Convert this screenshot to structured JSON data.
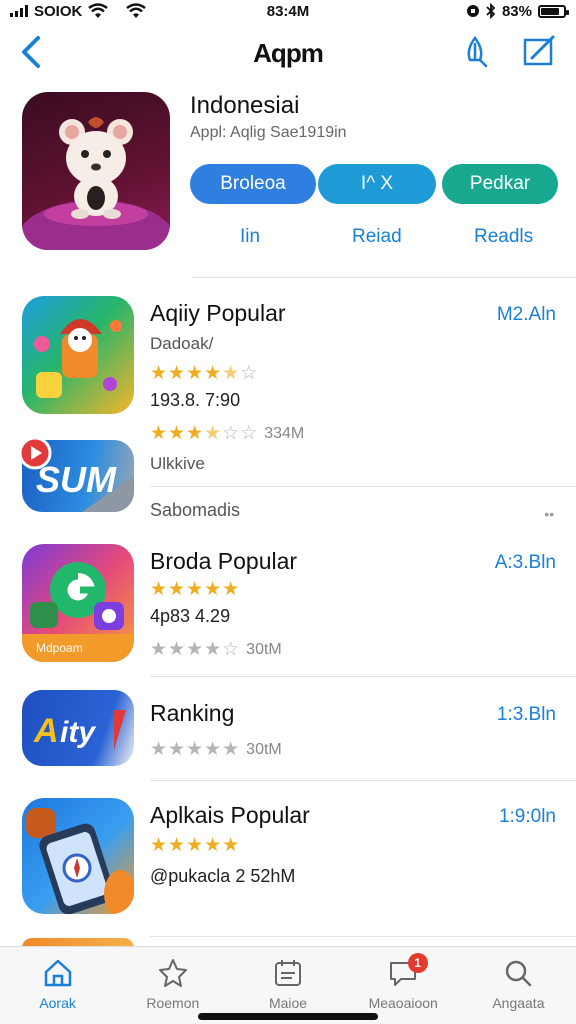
{
  "status": {
    "carrier": "SOIOK",
    "time": "83:4M",
    "battery": "83%"
  },
  "nav": {
    "title": "Aqpm",
    "back_icon": "chevron-left-icon",
    "share_icon": "share-icon",
    "edit_icon": "compose-icon"
  },
  "hero": {
    "title": "Indonesiai",
    "subtitle": "Appl: Aqlig Sae1919in",
    "buttons": [
      {
        "label": "Broleoa",
        "color": "#2f7fe0"
      },
      {
        "label": "I^ X",
        "color": "#1e9ad6"
      },
      {
        "label": "Pedkar",
        "color": "#17a88f"
      }
    ],
    "sub_labels": [
      "Iin",
      "Reiad",
      "Readls"
    ]
  },
  "rows": [
    {
      "title": "Aqiiy Popular",
      "price": "M2.Aln",
      "line1": "Dadoak/",
      "line2": "193.8. 7:90",
      "rating1": 4.5,
      "rating2": 3.5,
      "rating2_count": "334M"
    },
    {
      "subtitle": "Ulkkive",
      "footer": "Sabomadis"
    },
    {
      "title": "Broda Popular",
      "price": "A:3.Bln",
      "rating1": 5,
      "line1": "4p83 4.29",
      "rating2": 0,
      "rating2_count": "30tM"
    },
    {
      "title": "Ranking",
      "price": "1:3.Bln",
      "rating1": 0,
      "rating1_count": "30tM"
    },
    {
      "title": "Aplkais Popular",
      "price": "1:9:0ln",
      "rating1": 5,
      "line1": "@pukacla 2 52hM"
    }
  ],
  "row_icons": {
    "r1": "sugar-app-logo",
    "r2": "sum-app-logo",
    "r3": "camera-app-logo",
    "r4": "aity-app-logo",
    "r5": "phone-app-logo"
  },
  "tabs": [
    {
      "label": "Aorak",
      "icon": "home-icon",
      "active": true
    },
    {
      "label": "Roemon",
      "icon": "star-icon",
      "active": false
    },
    {
      "label": "Maioe",
      "icon": "calendar-icon",
      "active": false
    },
    {
      "label": "Meaoaioon",
      "icon": "chat-icon",
      "active": false,
      "badge": "1"
    },
    {
      "label": "Angaata",
      "icon": "search-icon",
      "active": false
    }
  ],
  "colors": {
    "accent": "#1a7fd8",
    "star": "#f0ad1c"
  }
}
